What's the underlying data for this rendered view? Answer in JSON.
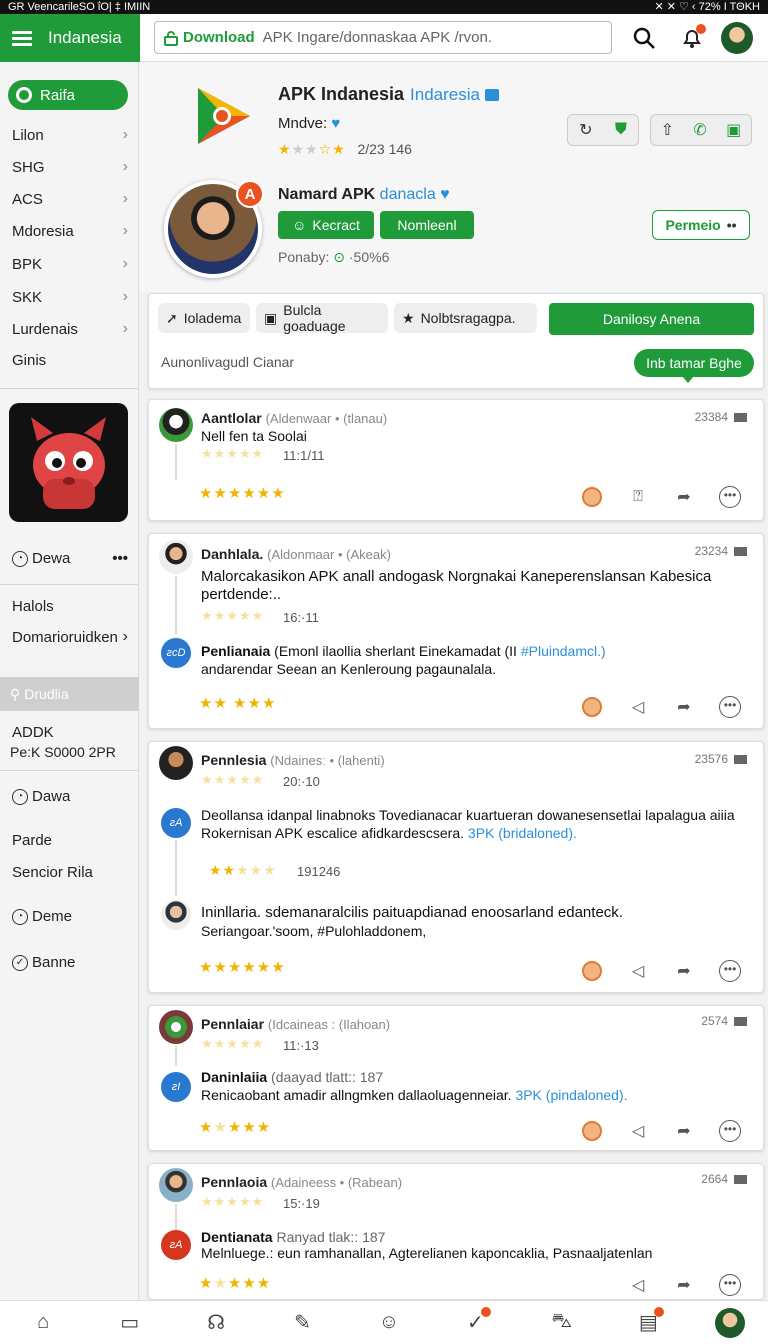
{
  "status": {
    "left": "GR VeencarileSO  ΐΟ| ‡ ΙΜΙΙΝ",
    "right": "✕ ✕ ♡ ‹ 72% Ι ΤΘΚΗ"
  },
  "header": {
    "brand": "Indanesia",
    "search_prefix": "Download",
    "search_placeholder": "APK Ingare/donnaskaa APK /rvon."
  },
  "sidebar": {
    "pill": "Raifa",
    "items": [
      "Lilon",
      "SHG",
      "ACS",
      "Mdoresia",
      "BPK",
      "SKK",
      "Lurdenais",
      "Ginis"
    ],
    "section2": {
      "dewa": "Dewa",
      "halos": "Halols",
      "domain": "Domarioruidken",
      "selected": "Drudlia",
      "addk": "ADDK",
      "pek": "Pe:K S0000 2PR",
      "dawa": "Dawa",
      "parde": "Parde",
      "sencior": "Sencior Rila",
      "deme": "Deme",
      "banne": "Banne"
    }
  },
  "app": {
    "name": "APK Indanesia",
    "name_sub": "Indaresia",
    "developer": "Mndve:",
    "rating_text": "2/23 146"
  },
  "publisher": {
    "name": "Namard APK",
    "name_sub": "danacla",
    "btn1": "Kecract",
    "btn2": "Nomleenl",
    "popularity": "Ponaby:",
    "popularity_val": "·50%6",
    "permission": "Permeio"
  },
  "toolbar": {
    "chip1": "Ioladema",
    "chip2": "Bulcla goaduage",
    "chip3": "Nolbtsragagpa.",
    "download": "Danilosy Anena",
    "caption": "Aunonlivagudl Cianar",
    "pill": "Inb tamar Bghe"
  },
  "reviews": [
    {
      "name": "Aantlolar",
      "meta": "(Aldenwaar • (tlanau)",
      "num": "23384",
      "text": "Nell fen ta Soolai",
      "time": "11:1/11"
    },
    {
      "name": "Danhlala.",
      "meta": "(Aldonmaar • (Akeak)",
      "num": "23234",
      "text": "Malorcakasikon APK anall andogask Norgnakai Kaneperenslansan Kabesica pertdende:..",
      "time": "16:·11",
      "reply": {
        "name": "Penlianaia",
        "text_a": "(Emonl ilaollia  sherlant Einekamadat (II",
        "link": "#Pluindamcl.)",
        "text_b": "andarendar Seean an Kenleroung pagaunalala."
      }
    },
    {
      "name": "Pennlesia",
      "meta": "(Ndainesː • (lahenti)",
      "num": "23576",
      "time": "20:·10",
      "text": "Deollansa idanpal linabnoks Tovedianacar kuartueran dowanesensetlai lapalagua aiiia Rokernisan APK escalice afidkardescsera.",
      "link": "3PK (bridaloned).",
      "sub_rating": "191246",
      "reply": {
        "name": "Ininllaria",
        "text": ". sdemanaralcilis paituapdianad enoosarland edanteck.",
        "link": "Seriangoar.'soom, #Pulohladdonem,"
      }
    },
    {
      "name": "Pennlaiar",
      "meta": "(Idcaineas : (Ilahoan)",
      "num": "2574",
      "time": "11:·13",
      "reply": {
        "name": "Daninlaiia",
        "meta": "(daayad tlatt:: 187",
        "text": "Renicaobant amadir allngmken dallaoluagenneiar.",
        "link": "3PK (pindaloned)."
      }
    },
    {
      "name": "Pennlaoia",
      "meta": "(Adaineess • (Rabean)",
      "num": "2664",
      "time": "15:·19",
      "reply": {
        "name": "Dentianata",
        "meta": "Ranyad tlak:: 187",
        "text": "Melnluege.: eun ramhanallan, Agterelianen kaponcaklia, Pasnaaljatenlan"
      }
    }
  ],
  "colors": {
    "accent": "#1f9b3a",
    "link": "#2a8fd8",
    "star": "#f0b400",
    "notify": "#e8531f"
  }
}
